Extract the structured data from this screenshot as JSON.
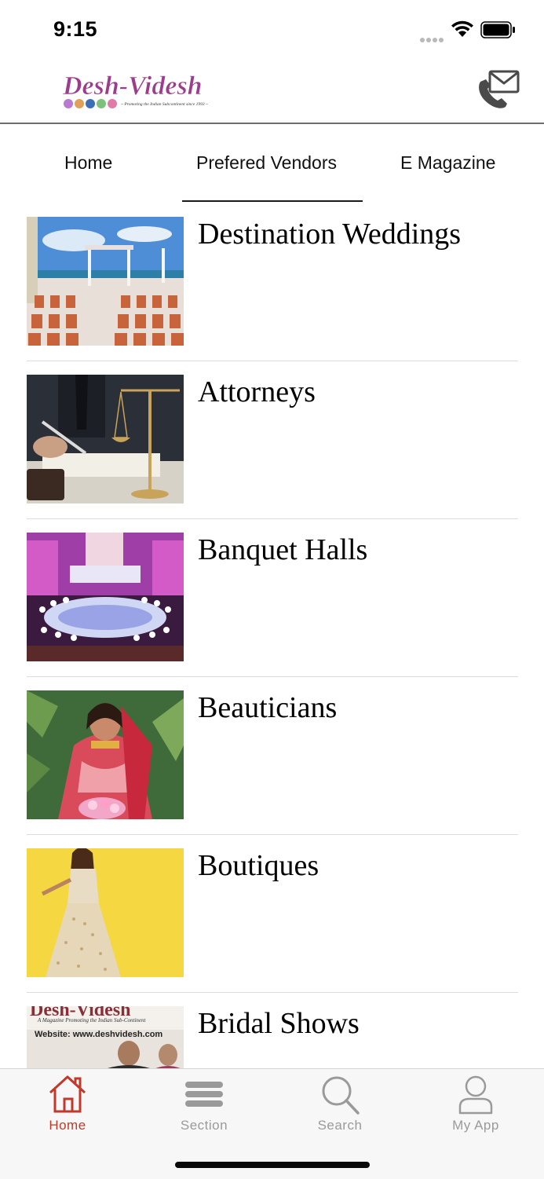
{
  "status_bar": {
    "time": "9:15"
  },
  "header": {
    "logo_text": "Desh-Videsh",
    "logo_tagline": "~ Promoting the Indian Subcontinent since 1993 ~",
    "contact_icon": "phone-mail-icon"
  },
  "tabs": [
    {
      "label": "Home",
      "active": false
    },
    {
      "label": "Prefered Vendors",
      "active": true
    },
    {
      "label": "E Magazine",
      "active": false
    }
  ],
  "vendors": [
    {
      "title": "Destination Weddings",
      "image": "beach-wedding-photo"
    },
    {
      "title": "Attorneys",
      "image": "scales-of-justice-photo"
    },
    {
      "title": "Banquet Halls",
      "image": "banquet-hall-photo"
    },
    {
      "title": "Beauticians",
      "image": "bride-photo"
    },
    {
      "title": "Boutiques",
      "image": "lehenga-model-photo"
    },
    {
      "title": "Bridal Shows",
      "image": "bridal-show-banner-photo"
    }
  ],
  "bridal_banner_text": {
    "brand": "Desh-Videsh",
    "tagline": "A Magazine Promoting the Indian Sub-Continent",
    "website": "Website: www.deshvidesh.com"
  },
  "tabbar": [
    {
      "label": "Home",
      "icon": "home-icon",
      "active": true
    },
    {
      "label": "Section",
      "icon": "menu-icon",
      "active": false
    },
    {
      "label": "Search",
      "icon": "search-icon",
      "active": false
    },
    {
      "label": "My App",
      "icon": "user-icon",
      "active": false
    }
  ],
  "colors": {
    "accent": "#c0392b",
    "logo_purple": "#9b3d8c",
    "tab_inactive": "#9a9a9a"
  }
}
